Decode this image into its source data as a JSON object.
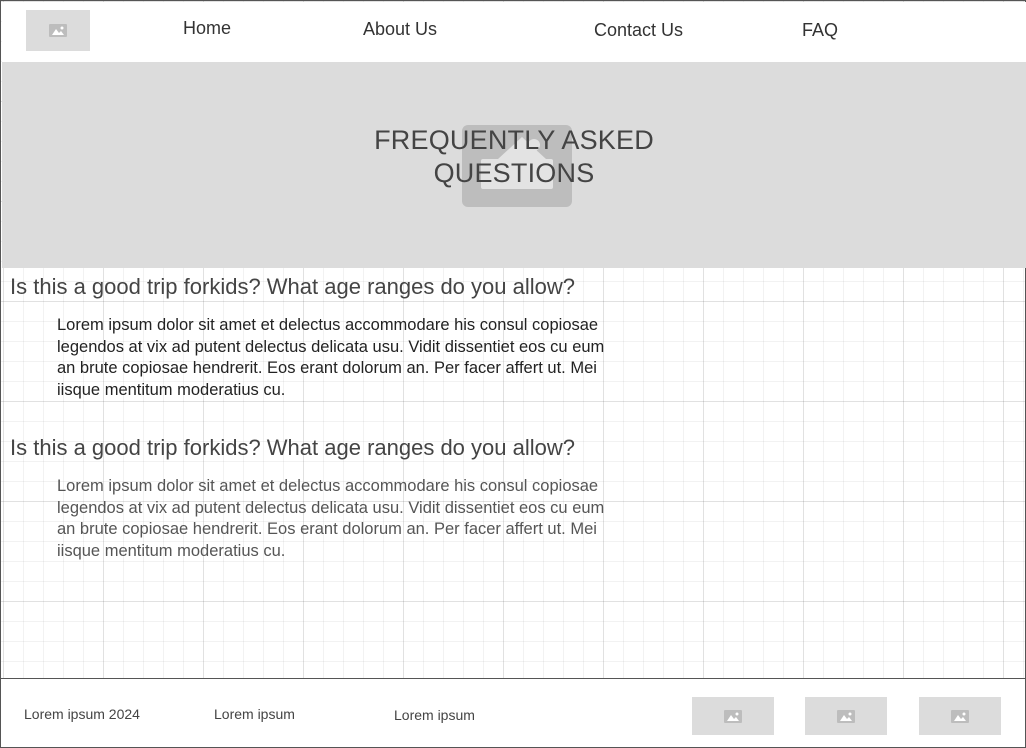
{
  "header": {
    "logo_icon": "image-placeholder-icon",
    "nav": [
      {
        "label": "Home"
      },
      {
        "label": "About Us"
      },
      {
        "label": "Contact Us"
      },
      {
        "label": "FAQ"
      }
    ]
  },
  "hero": {
    "title_line1": "FREQUENTLY ASKED",
    "title_line2": "QUESTIONS",
    "background_icon": "image-placeholder-icon"
  },
  "faq": [
    {
      "question": "Is this a good trip forkids? What age ranges do you allow?",
      "answer": "Lorem ipsum dolor sit amet et delectus accommodare his consul copiosae legendos at vix ad putent delectus delicata usu. Vidit dissentiet eos cu eum an brute copiosae hendrerit. Eos erant dolorum an. Per facer affert ut. Mei iisque mentitum moderatius cu."
    },
    {
      "question": "Is this a good trip forkids? What age ranges do you allow?",
      "answer": "Lorem ipsum dolor sit amet et delectus accommodare his consul copiosae legendos at vix ad putent delectus delicata usu. Vidit dissentiet eos cu eum an brute copiosae hendrerit. Eos erant dolorum an. Per facer affert ut. Mei iisque mentitum moderatius cu."
    }
  ],
  "footer": {
    "copyright": "Lorem ipsum 2024",
    "link1": "Lorem ipsum",
    "link2": "Lorem ipsum",
    "social_icons": [
      "image-placeholder-icon",
      "image-placeholder-icon",
      "image-placeholder-icon"
    ]
  },
  "colors": {
    "placeholder_fill": "#dcdcdc",
    "hero_image_fill": "#bdbdbd",
    "text": "#444444",
    "border": "#555555"
  }
}
